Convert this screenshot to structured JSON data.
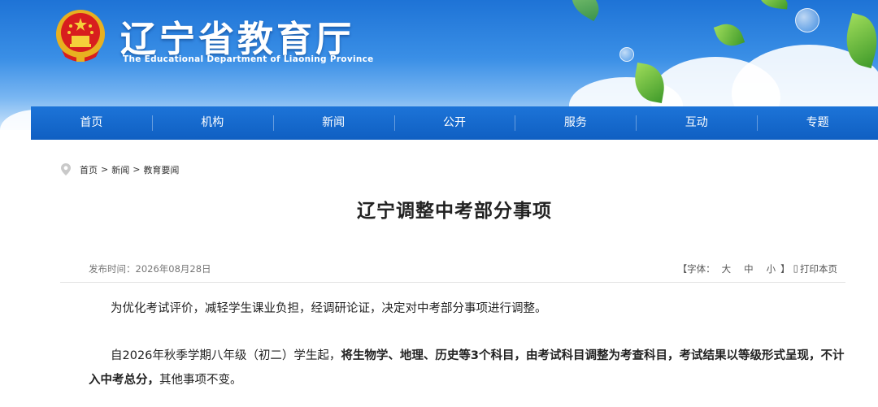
{
  "header": {
    "site_title": "辽宁省教育厅",
    "site_subtitle": "The Educational Department of Liaoning Province"
  },
  "nav": {
    "items": [
      {
        "label": "首页"
      },
      {
        "label": "机构"
      },
      {
        "label": "新闻"
      },
      {
        "label": "公开"
      },
      {
        "label": "服务"
      },
      {
        "label": "互动"
      },
      {
        "label": "专题"
      }
    ]
  },
  "breadcrumb": {
    "home": "首页",
    "sep": ">",
    "level1": "新闻",
    "level2": "教育要闻"
  },
  "article": {
    "title": "辽宁调整中考部分事项",
    "publish_label": "发布时间：",
    "publish_date": "2026年08月28日",
    "font_label": "【字体：",
    "font_large": "大",
    "font_medium": "中",
    "font_small": "小",
    "font_close": "】",
    "print_label": "打印本页",
    "paragraph1": "为优化考试评价，减轻学生课业负担，经调研论证，决定对中考部分事项进行调整。",
    "paragraph2_prefix": "自2026年秋季学期八年级（初二）学生起，",
    "paragraph2_bold": "将生物学、地理、历史等3个科目，由考试科目调整为考查科目，考试结果以等级形式呈现，不计入中考总分，",
    "paragraph2_suffix": "其他事项不变。"
  },
  "colors": {
    "nav_blue": "#1068cc",
    "banner_blue": "#2a80e0"
  },
  "icons": {
    "emblem": "national-emblem-icon",
    "location": "location-pin-icon",
    "print": "print-icon"
  }
}
